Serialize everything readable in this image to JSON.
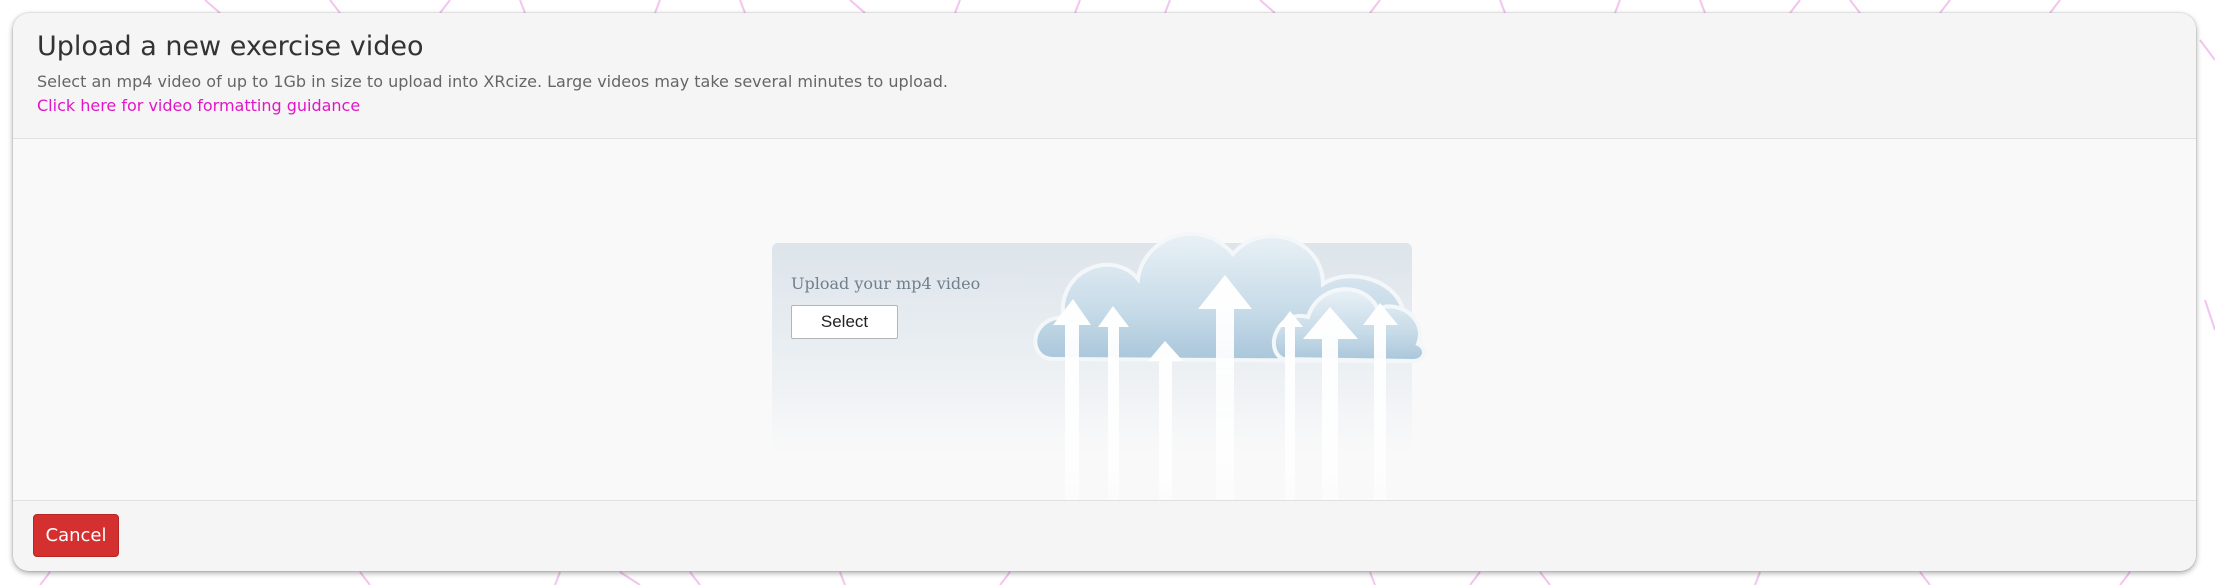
{
  "modal": {
    "title": "Upload a new exercise video",
    "subtitle": "Select an mp4 video of up to 1Gb in size to upload into XRcize. Large videos may take several minutes to upload.",
    "guidance_link": "Click here for video formatting guidance"
  },
  "upload": {
    "label": "Upload your mp4 video",
    "select_label": "Select",
    "illustration_icon": "cloud-upload-icon"
  },
  "footer": {
    "cancel_label": "Cancel"
  },
  "colors": {
    "link": "#e216c8",
    "cancel_bg": "#d3302f",
    "background_pattern": "#f2c4ee"
  }
}
